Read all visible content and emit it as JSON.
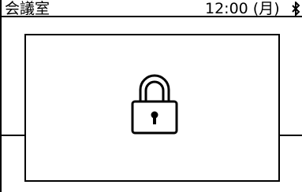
{
  "status_bar": {
    "room_name": "会議室",
    "clock": "12:00 (月)",
    "bluetooth_icon": "bluetooth-icon"
  },
  "lock_dialog": {
    "icon": "lock-icon"
  },
  "colors": {
    "background": "#ffffff",
    "foreground": "#000000"
  }
}
